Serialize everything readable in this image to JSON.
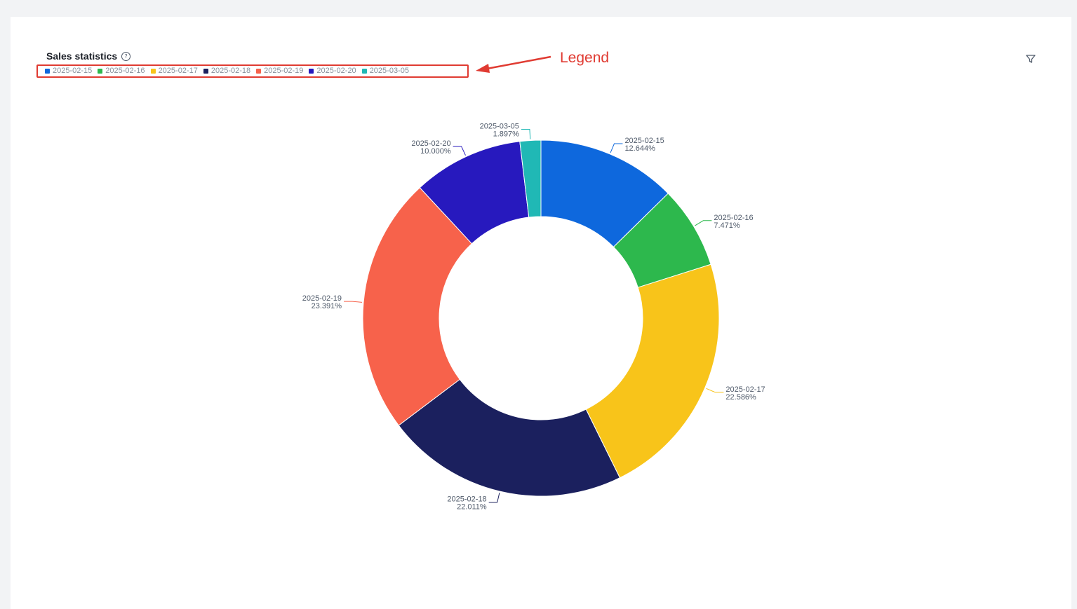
{
  "header": {
    "title": "Sales statistics",
    "help_glyph": "?",
    "filter_icon": "filter-icon"
  },
  "annotation": {
    "text": "Legend",
    "color": "#e03b32"
  },
  "colors": {
    "background": "#f2f3f5",
    "card": "#ffffff"
  },
  "chart_data": {
    "type": "pie",
    "variant": "donut",
    "title": "Sales statistics",
    "legend_position": "top-left",
    "slices": [
      {
        "label": "2025-02-15",
        "percent": 12.644,
        "percent_text": "12.644%",
        "color": "#0e68dd"
      },
      {
        "label": "2025-02-16",
        "percent": 7.471,
        "percent_text": "7.471%",
        "color": "#2db84d"
      },
      {
        "label": "2025-02-17",
        "percent": 22.586,
        "percent_text": "22.586%",
        "color": "#f8c41a"
      },
      {
        "label": "2025-02-18",
        "percent": 22.011,
        "percent_text": "22.011%",
        "color": "#1b205e"
      },
      {
        "label": "2025-02-19",
        "percent": 23.391,
        "percent_text": "23.391%",
        "color": "#f7624b"
      },
      {
        "label": "2025-02-20",
        "percent": 10.0,
        "percent_text": "10.000%",
        "color": "#2719be"
      },
      {
        "label": "2025-03-05",
        "percent": 1.897,
        "percent_text": "1.897%",
        "color": "#20b8b5"
      }
    ]
  }
}
